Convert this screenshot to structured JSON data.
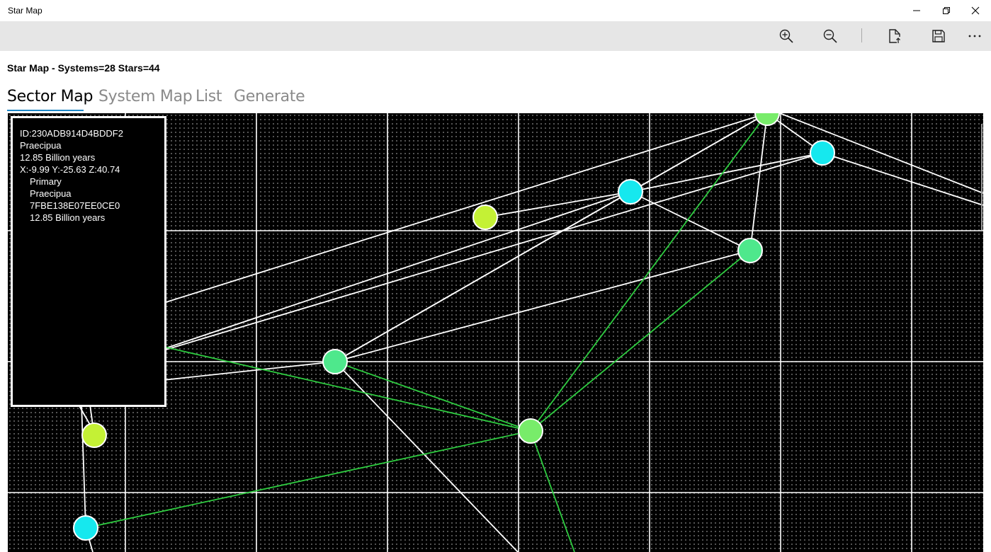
{
  "window": {
    "title": "Star Map",
    "controls": [
      "minimize",
      "restore",
      "close"
    ]
  },
  "toolbar": {
    "buttons": [
      {
        "name": "zoom-in",
        "icon": "zoom-in-icon"
      },
      {
        "name": "zoom-out",
        "icon": "zoom-out-icon"
      },
      {
        "name": "export",
        "icon": "document-export-icon"
      },
      {
        "name": "save",
        "icon": "save-icon"
      },
      {
        "name": "more",
        "icon": "more-ellipsis-icon"
      }
    ]
  },
  "heading": "Star Map - Systems=28 Stars=44",
  "tabs": [
    {
      "label": "Sector Map",
      "active": true
    },
    {
      "label": "System Map",
      "active": false
    },
    {
      "label": "List",
      "active": false
    },
    {
      "label": "Generate",
      "active": false
    }
  ],
  "info_popup": {
    "id_line": "ID:230ADB914D4BDDF2",
    "name": "Praecipua",
    "age": "12.85 Billion years",
    "coords": "X:-9.99 Y:-25.63 Z:40.74",
    "star": {
      "role": "Primary",
      "name": "Praecipua",
      "id": "7FBE138E07EE0CE0",
      "age": "12.85 Billion years"
    }
  },
  "colors": {
    "map_background": "#000000",
    "grid_line": "#ffffff",
    "white_link": "#ffffff",
    "green_link": "#2ecc40",
    "node_yellow_green": "#c4f135",
    "node_cyan": "#16e8ee",
    "node_green": "#4ee88c",
    "node_light_green": "#78ec6a",
    "tab_underline": "#1e88c8"
  }
}
